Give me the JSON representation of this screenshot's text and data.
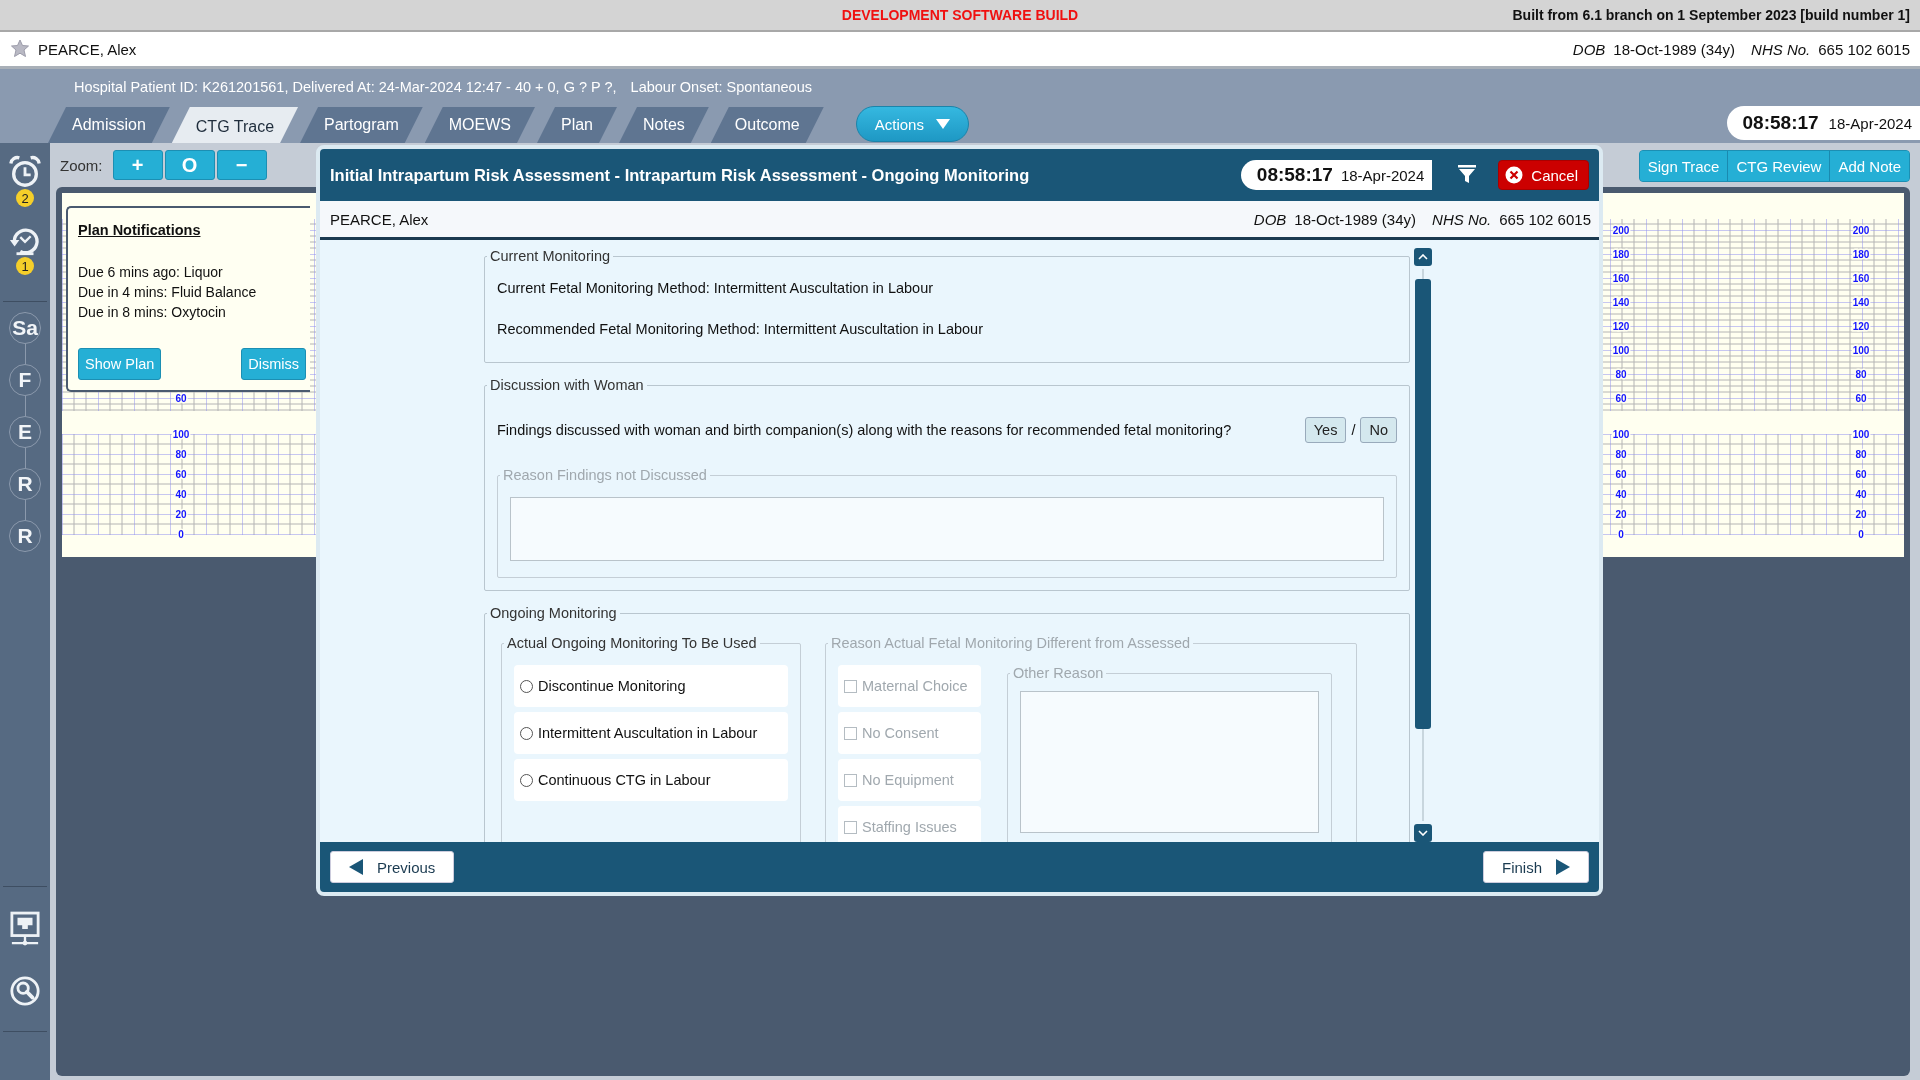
{
  "build_banner": {
    "label": "DEVELOPMENT SOFTWARE BUILD",
    "build_info": "Built from 6.1 branch on 1 September 2023 [build number 1]"
  },
  "patient_bar": {
    "name": "PEARCE, Alex",
    "dob_label": "DOB",
    "dob": "18-Oct-1989 (34y)",
    "nhs_label": "NHS No.",
    "nhs_number": "665 102 6015"
  },
  "encounter_info": [
    "Hospital Patient ID: K261201561, Delivered At: 24-Mar-2024 12:47 - 40 + 0, G ? P ?,",
    "Labour Onset: Spontaneous"
  ],
  "tabs": [
    {
      "label": "Admission",
      "selected": false
    },
    {
      "label": "CTG Trace",
      "selected": true
    },
    {
      "label": "Partogram",
      "selected": false
    },
    {
      "label": "MOEWS",
      "selected": false
    },
    {
      "label": "Plan",
      "selected": false
    },
    {
      "label": "Notes",
      "selected": false
    },
    {
      "label": "Outcome",
      "selected": false
    }
  ],
  "actions_button": "Actions",
  "clock": {
    "time": "08:58:17",
    "date": "18-Apr-2024"
  },
  "sidebar": {
    "alarm_badge": "2",
    "snooze_badge": "1",
    "steps": [
      "Sa",
      "F",
      "E",
      "R",
      "R"
    ]
  },
  "zoom": {
    "label": "Zoom:",
    "buttons": [
      "+",
      "O",
      "−"
    ]
  },
  "trace_buttons": [
    "Sign Trace",
    "CTG Review",
    "Add Note"
  ],
  "ctg_chart": {
    "left_axis": {
      "heart_rate_ticks": [
        "60"
      ],
      "contraction_ticks": [
        "100",
        "80",
        "60",
        "40",
        "20",
        "0"
      ]
    },
    "right_axes": [
      {
        "heart_rate_ticks": [
          "200",
          "180",
          "160",
          "140",
          "120",
          "100",
          "80",
          "60"
        ],
        "contraction_ticks": [
          "100",
          "80",
          "60",
          "40",
          "20",
          "0"
        ]
      },
      {
        "heart_rate_ticks": [
          "200",
          "180",
          "160",
          "140",
          "120",
          "100",
          "80",
          "60"
        ],
        "contraction_ticks": [
          "100",
          "80",
          "60",
          "40",
          "20",
          "0"
        ]
      }
    ]
  },
  "plan_notifications": {
    "title": "Plan Notifications",
    "items": [
      "Due 6 mins ago: Liquor",
      "Due in 4 mins: Fluid Balance",
      "Due in 8 mins: Oxytocin"
    ],
    "buttons": [
      "Show Plan",
      "Dismiss"
    ]
  },
  "dialog": {
    "title": "Initial Intrapartum Risk Assessment - Intrapartum Risk Assessment - Ongoing Monitoring",
    "time": "08:58:17",
    "date": "18-Apr-2024",
    "cancel": "Cancel",
    "patient": {
      "name": "PEARCE, Alex",
      "dob_label": "DOB",
      "dob": "18-Oct-1989 (34y)",
      "nhs_label": "NHS No.",
      "nhs_number": "665 102 6015"
    },
    "sections": [
      {
        "kind": "info",
        "legend": "Current Monitoring",
        "lines": [
          "Current Fetal Monitoring Method: Intermittent Auscultation in Labour",
          "Recommended Fetal Monitoring Method: Intermittent Auscultation in Labour"
        ]
      },
      {
        "kind": "question",
        "legend": "Discussion with Woman",
        "question": "Findings discussed with woman and birth companion(s) along with the reasons for recommended fetal monitoring?",
        "options": [
          {
            "label": "Yes",
            "selected": false
          },
          {
            "label": "No",
            "selected": false
          }
        ],
        "separator": "/",
        "subfield": {
          "legend": "Reason Findings not Discussed",
          "disabled": true
        }
      },
      {
        "kind": "monitoring",
        "legend": "Ongoing Monitoring",
        "choice": {
          "legend": "Actual Ongoing Monitoring To Be Used",
          "options": [
            {
              "label": "Discontinue Monitoring",
              "selected": false
            },
            {
              "label": "Intermittent Auscultation in Labour",
              "selected": false
            },
            {
              "label": "Continuous CTG in Labour",
              "selected": false
            }
          ]
        },
        "reasons": {
          "legend": "Reason Actual Fetal Monitoring Different from Assessed",
          "disabled": true,
          "options": [
            {
              "label": "Maternal Choice",
              "checked": false
            },
            {
              "label": "No Consent",
              "checked": false
            },
            {
              "label": "No Equipment",
              "checked": false
            },
            {
              "label": "Staffing Issues",
              "checked": false
            }
          ],
          "other_legend": "Other Reason"
        }
      }
    ],
    "previous": "Previous",
    "finish": "Finish"
  }
}
